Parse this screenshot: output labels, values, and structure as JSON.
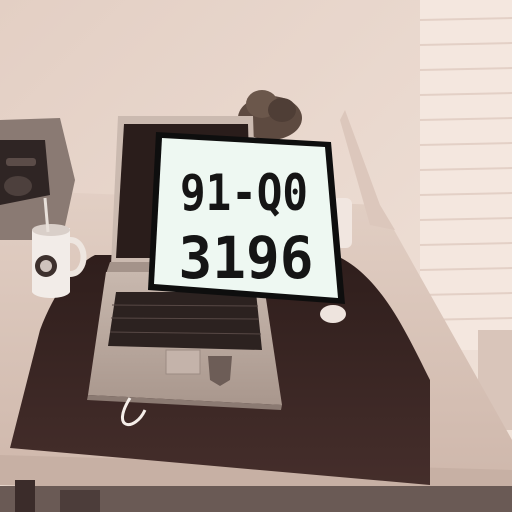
{
  "photo": {
    "description_tone": "sepia",
    "colors": {
      "wall": "#ead8cd",
      "desk_surface": "#d8c3b6",
      "desk_pad": "#3a2624",
      "laptop_body": "#b9a9a0",
      "plate_background": "#eef8f2",
      "plate_border": "#0e0e0e",
      "plate_text": "#151515"
    }
  },
  "plate": {
    "line1": "91-Q0",
    "line2": "3196"
  }
}
